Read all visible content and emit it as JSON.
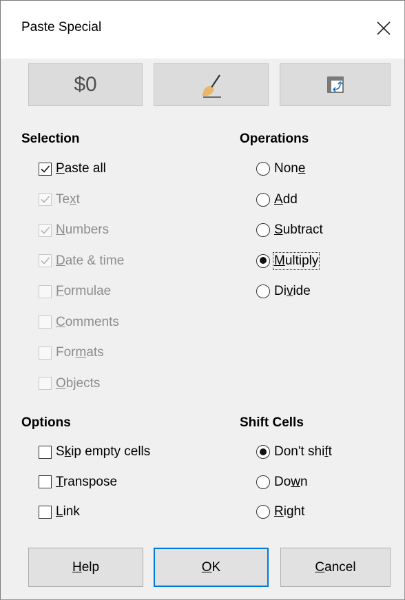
{
  "window": {
    "title": "Paste Special"
  },
  "presets": [
    {
      "label": "$0",
      "icon": "values-only-icon"
    },
    {
      "label": "",
      "icon": "formats-only-brush-icon"
    },
    {
      "label": "",
      "icon": "transpose-icon"
    }
  ],
  "selection": {
    "title": "Selection",
    "items": [
      {
        "pre": "",
        "key": "P",
        "post": "aste all",
        "checked": true,
        "enabled": true
      },
      {
        "pre": "Te",
        "key": "x",
        "post": "t",
        "checked": true,
        "enabled": false
      },
      {
        "pre": "",
        "key": "N",
        "post": "umbers",
        "checked": true,
        "enabled": false
      },
      {
        "pre": "",
        "key": "D",
        "post": "ate & time",
        "checked": true,
        "enabled": false
      },
      {
        "pre": "",
        "key": "F",
        "post": "ormulae",
        "checked": false,
        "enabled": false
      },
      {
        "pre": "",
        "key": "C",
        "post": "omments",
        "checked": false,
        "enabled": false
      },
      {
        "pre": "For",
        "key": "m",
        "post": "ats",
        "checked": false,
        "enabled": false
      },
      {
        "pre": "",
        "key": "O",
        "post": "bjects",
        "checked": false,
        "enabled": false
      }
    ]
  },
  "operations": {
    "title": "Operations",
    "items": [
      {
        "pre": "Non",
        "key": "e",
        "post": "",
        "selected": false
      },
      {
        "pre": "",
        "key": "A",
        "post": "dd",
        "selected": false
      },
      {
        "pre": "",
        "key": "S",
        "post": "ubtract",
        "selected": false
      },
      {
        "pre": "",
        "key": "M",
        "post": "ultiply",
        "selected": true
      },
      {
        "pre": "Di",
        "key": "v",
        "post": "ide",
        "selected": false
      }
    ]
  },
  "options": {
    "title": "Options",
    "items": [
      {
        "pre": "S",
        "key": "k",
        "post": "ip empty cells",
        "checked": false
      },
      {
        "pre": "",
        "key": "T",
        "post": "ranspose",
        "checked": false
      },
      {
        "pre": "",
        "key": "L",
        "post": "ink",
        "checked": false
      }
    ]
  },
  "shift_cells": {
    "title": "Shift Cells",
    "items": [
      {
        "pre": "Don't shi",
        "key": "f",
        "post": "t",
        "selected": true
      },
      {
        "pre": "Do",
        "key": "w",
        "post": "n",
        "selected": false
      },
      {
        "pre": "",
        "key": "R",
        "post": "ight",
        "selected": false
      }
    ]
  },
  "buttons": {
    "help": {
      "pre": "",
      "key": "H",
      "post": "elp"
    },
    "ok": {
      "pre": "",
      "key": "O",
      "post": "K"
    },
    "cancel": {
      "pre": "",
      "key": "C",
      "post": "ancel"
    }
  },
  "colors": {
    "accent": "#0078d7",
    "brush": "#e8b86a",
    "disabled_text": "#8d8d8d"
  }
}
